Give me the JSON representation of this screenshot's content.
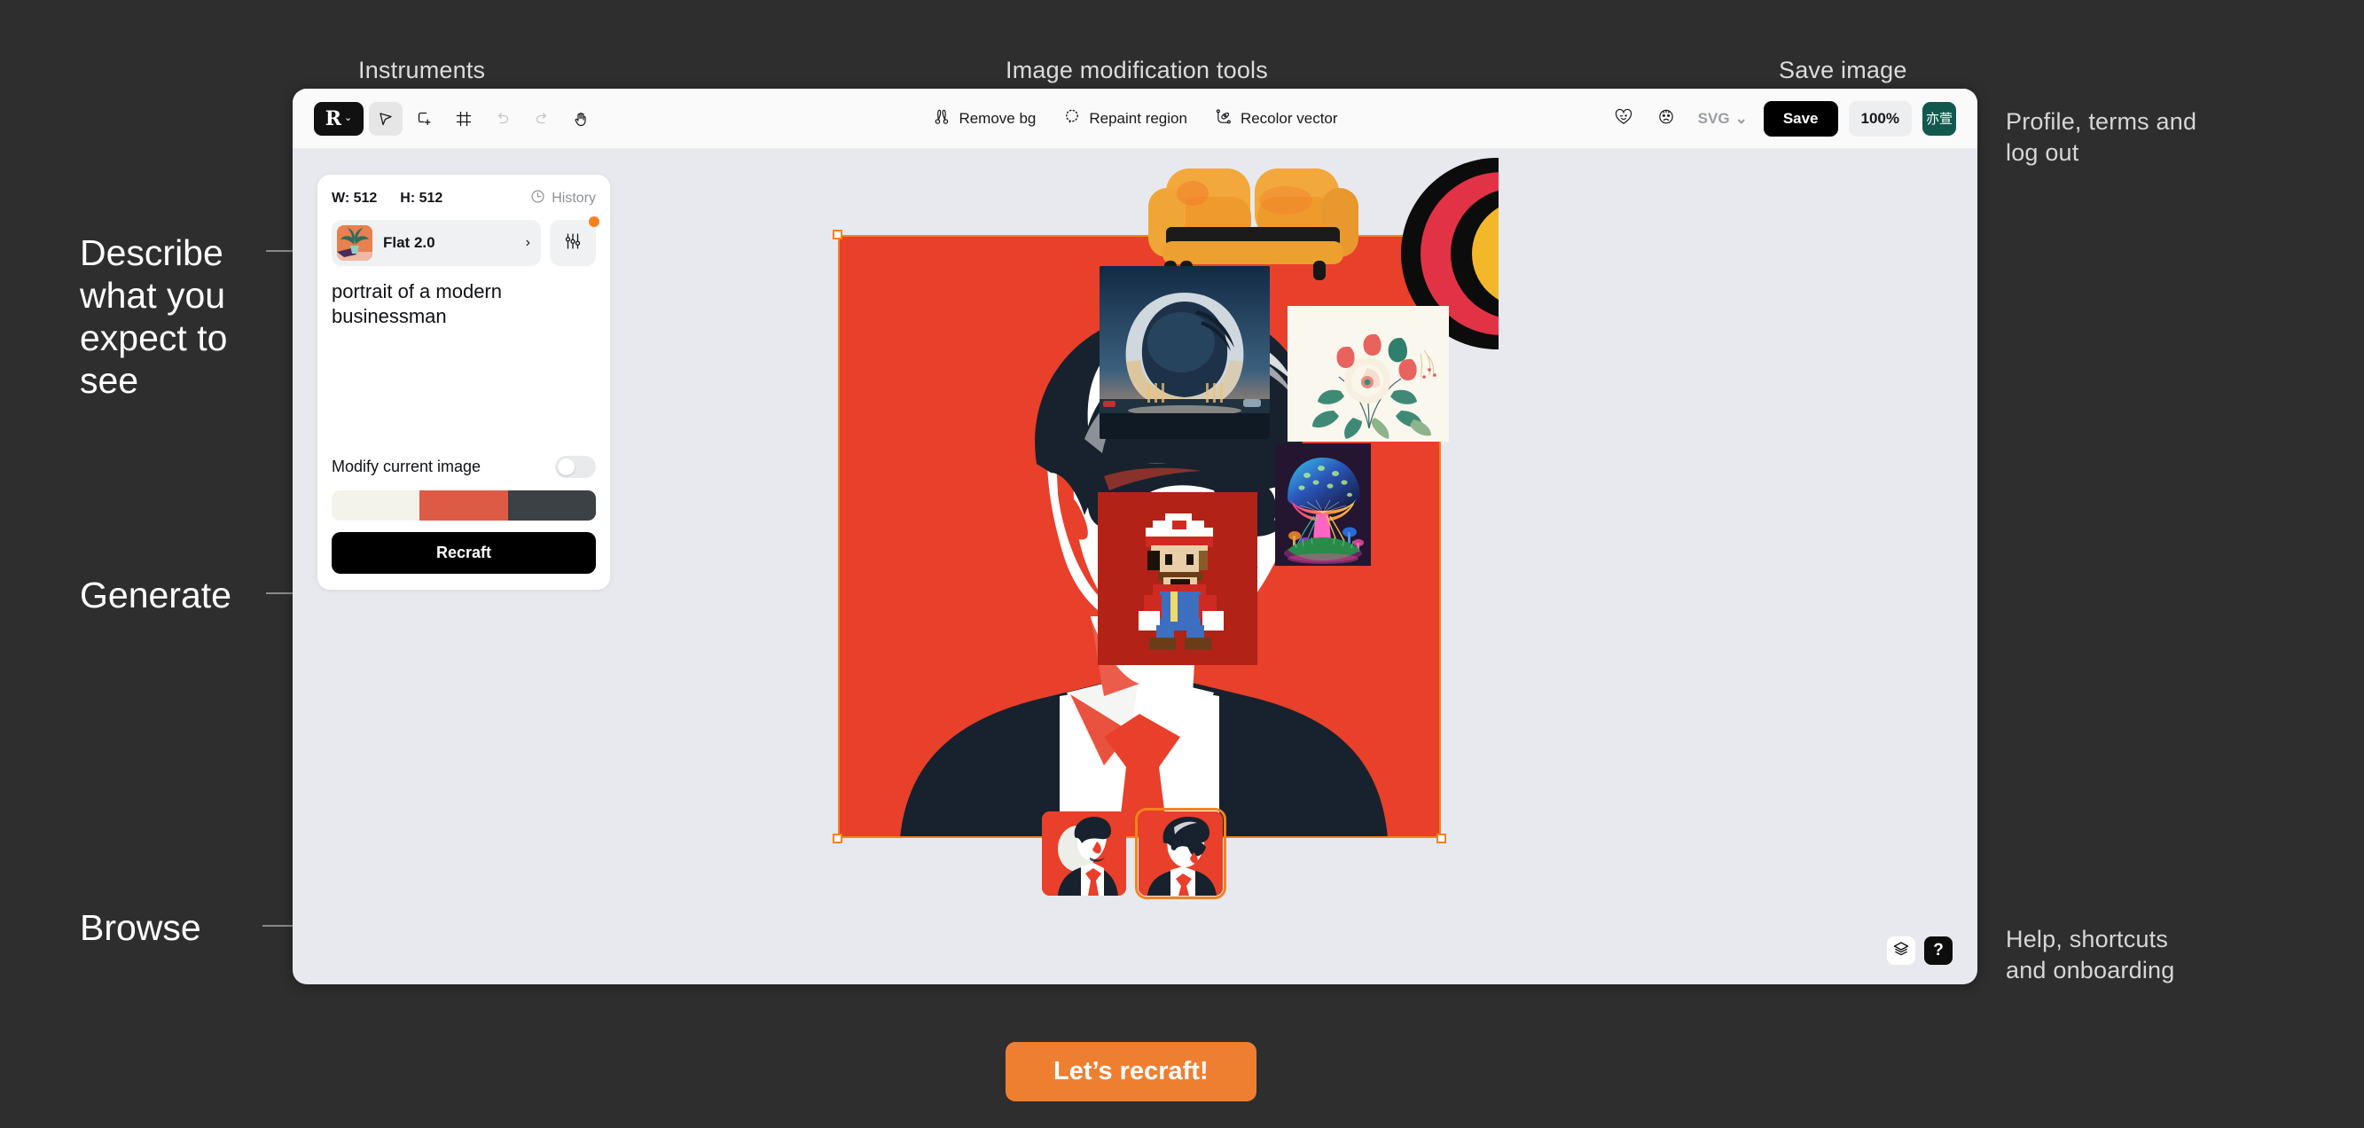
{
  "annotations": {
    "instruments": "Instruments",
    "image_modification_tools": "Image modification tools",
    "save_image": "Save image",
    "profile": "Profile, terms and\nlog out",
    "describe": "Describe\nwhat you\nexpect to\nsee",
    "generate": "Generate",
    "browse": "Browse",
    "help": "Help, shortcuts\nand onboarding"
  },
  "toolbar": {
    "brand_letter": "R",
    "chevron": "⌄",
    "tools": [
      {
        "name": "select-tool",
        "title": "Select"
      },
      {
        "name": "add-shape-tool",
        "title": "Add"
      },
      {
        "name": "frame-tool",
        "title": "Frame"
      },
      {
        "name": "undo-tool",
        "title": "Undo"
      },
      {
        "name": "redo-tool",
        "title": "Redo"
      },
      {
        "name": "hand-tool",
        "title": "Hand"
      }
    ],
    "center_items": [
      {
        "label": "Remove bg",
        "icon": "scissors-icon"
      },
      {
        "label": "Repaint region",
        "icon": "lasso-icon"
      },
      {
        "label": "Recolor vector",
        "icon": "recolor-icon"
      }
    ],
    "format": "SVG",
    "format_chevron": "⌄",
    "save_label": "Save",
    "zoom_level": "100%",
    "avatar_text": "亦萱"
  },
  "panel": {
    "width_label": "W: 512",
    "height_label": "H: 512",
    "history_label": "History",
    "style_name": "Flat 2.0",
    "style_arrow": "›",
    "prompt_text": "portrait of a modern businessman",
    "modify_label": "Modify current image",
    "modify_enabled": false,
    "palette": [
      "#f4f3e9",
      "#dd5b45",
      "#3c4146"
    ],
    "recraft_label": "Recraft"
  },
  "canvas": {
    "selected_thumbnail_index": 1,
    "thumbnail_count": 2
  },
  "gallery": {
    "items": [
      {
        "name": "yellow-sofa-image"
      },
      {
        "name": "red-circle-graphic-image"
      },
      {
        "name": "futuristic-architecture-image"
      },
      {
        "name": "floral-illustration-image"
      },
      {
        "name": "pixel-art-character-image"
      },
      {
        "name": "neon-mushroom-image"
      }
    ]
  },
  "bottom_tools": {
    "layers_icon": "layers-icon",
    "help_label": "?"
  },
  "cta": {
    "label": "Let’s recraft!"
  },
  "colors": {
    "background": "#2e2e2e",
    "app_bg": "#e7e9ee",
    "accent_orange": "#ef7f30",
    "selection_orange": "#f5821f",
    "portrait_red": "#e8402a",
    "portrait_navy": "#17222e",
    "avatar_green": "#13584d"
  }
}
